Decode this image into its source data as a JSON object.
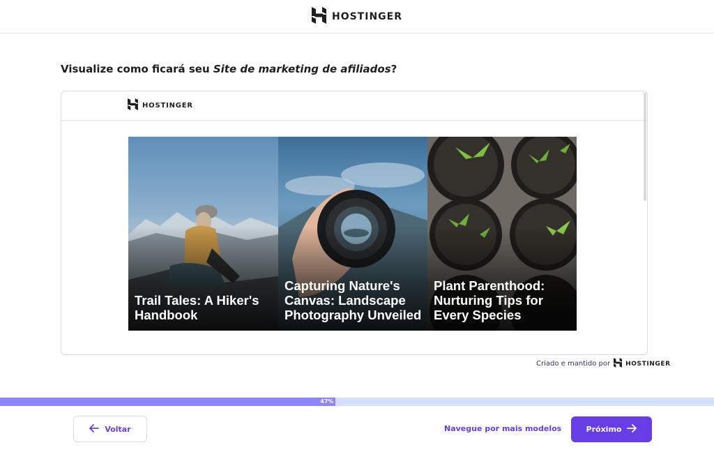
{
  "header": {
    "brand": "HOSTINGER"
  },
  "question": {
    "prefix": "Visualize como ficará seu ",
    "site_type": "Site de marketing de afiliados",
    "suffix": "?"
  },
  "preview": {
    "brand": "HOSTINGER",
    "cards": [
      {
        "title": "Trail Tales: A Hiker's Handbook"
      },
      {
        "title": "Capturing Nature's Canvas: Landscape Photography Unveiled"
      },
      {
        "title": "Plant Parenthood: Nurturing Tips for Every Species"
      }
    ]
  },
  "credit": {
    "text": "Criado e mantido por",
    "brand": "HOSTINGER"
  },
  "progress": {
    "percent": 47,
    "label": "47%"
  },
  "footer": {
    "back_label": "Voltar",
    "browse_label": "Navegue por mais modelos",
    "next_label": "Próximo"
  },
  "colors": {
    "accent": "#673de6",
    "progress_fill": "#8c85ff",
    "progress_track": "#d5dfff"
  },
  "icons": [
    "hostinger-logo-icon",
    "arrow-left-icon",
    "arrow-right-icon"
  ]
}
